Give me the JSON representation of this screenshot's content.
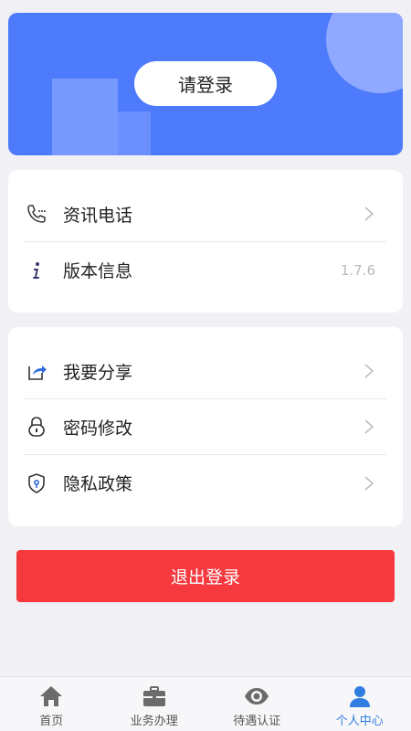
{
  "banner": {
    "login_label": "请登录"
  },
  "card1": {
    "items": [
      {
        "label": "资讯电话",
        "icon": "phone-icon"
      },
      {
        "label": "版本信息",
        "icon": "info-icon",
        "value": "1.7.6"
      }
    ]
  },
  "card2": {
    "items": [
      {
        "label": "我要分享",
        "icon": "share-icon"
      },
      {
        "label": "密码修改",
        "icon": "lock-icon"
      },
      {
        "label": "隐私政策",
        "icon": "shield-icon"
      }
    ]
  },
  "logout_label": "退出登录",
  "tabbar": {
    "tabs": [
      {
        "label": "首页",
        "icon": "home-icon",
        "active": false
      },
      {
        "label": "业务办理",
        "icon": "briefcase-icon",
        "active": false
      },
      {
        "label": "待遇认证",
        "icon": "eye-icon",
        "active": false
      },
      {
        "label": "个人中心",
        "icon": "person-icon",
        "active": true
      }
    ]
  },
  "colors": {
    "banner": "#4d7bfb",
    "logout": "#f5393f",
    "active_tab": "#2f7de1"
  }
}
